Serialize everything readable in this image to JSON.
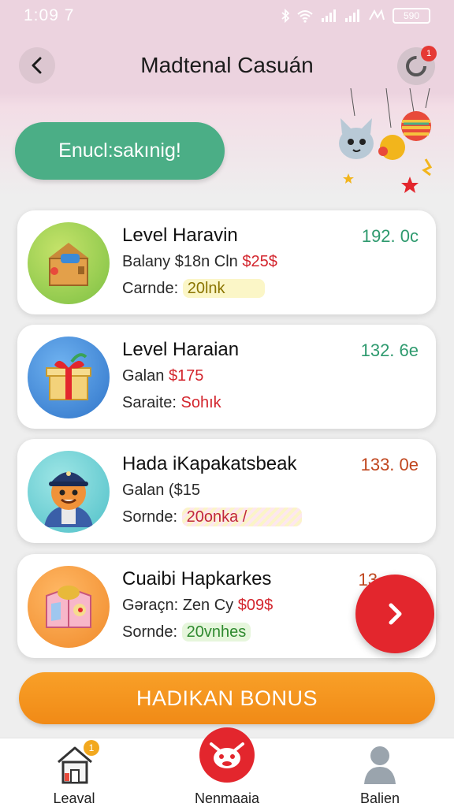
{
  "status_bar": {
    "time": "1:09 7",
    "icons": [
      "bluetooth-icon",
      "wifi-icon",
      "signal-icon",
      "signal-icon",
      "nfc-icon"
    ],
    "battery": "590"
  },
  "header": {
    "title": "Madtenal Casuán",
    "notif_count": "1"
  },
  "pill_button": {
    "label": "Enucl:sakınig!"
  },
  "cards": [
    {
      "title": "Level Haravin",
      "value": "192. 0c",
      "value_color": "#2e9a6e",
      "line1": {
        "label": "Balany $18n Cln ",
        "highlight": "$25$"
      },
      "line2": {
        "label": "Carnde: ",
        "tag": "20lnk"
      },
      "icon": "treasure-box-icon"
    },
    {
      "title": "Level Haraian",
      "value": "132. 6e",
      "value_color": "#2e9a6e",
      "line1": {
        "label": "Galan ",
        "highlight": "$175"
      },
      "line2": {
        "label": "Saraite: ",
        "tag": "Sohık"
      },
      "icon": "gift-box-icon"
    },
    {
      "title": "Hada iKapakatsbeak",
      "value": "133. 0e",
      "value_color": "#c0461e",
      "line1": {
        "label": "Galan ($15",
        "highlight": ""
      },
      "line2": {
        "label": "Sornde: ",
        "tag": "20onka /"
      },
      "icon": "pilot-character-icon"
    },
    {
      "title": "Cuaibi Hapkarkes",
      "value": "13",
      "value_color": "#c0461e",
      "line1": {
        "label": "Gəraçn: Zen Cy ",
        "highlight": "$09$"
      },
      "line2": {
        "label": "Sornde: ",
        "tag": "20vnhes"
      },
      "icon": "toy-box-icon"
    }
  ],
  "bonus_button": {
    "label": "HADIKAN BONUS"
  },
  "bottom_nav": [
    {
      "label": "Leaval",
      "icon": "home-icon",
      "badge": "1"
    },
    {
      "label": "Nenmaaia",
      "icon": "cow-face-icon"
    },
    {
      "label": "Balien",
      "icon": "user-icon"
    }
  ],
  "colors": {
    "accent_green": "#4bae86",
    "accent_orange": "#f18a16",
    "accent_red": "#e3262d",
    "header_pink": "#ecd3df"
  }
}
